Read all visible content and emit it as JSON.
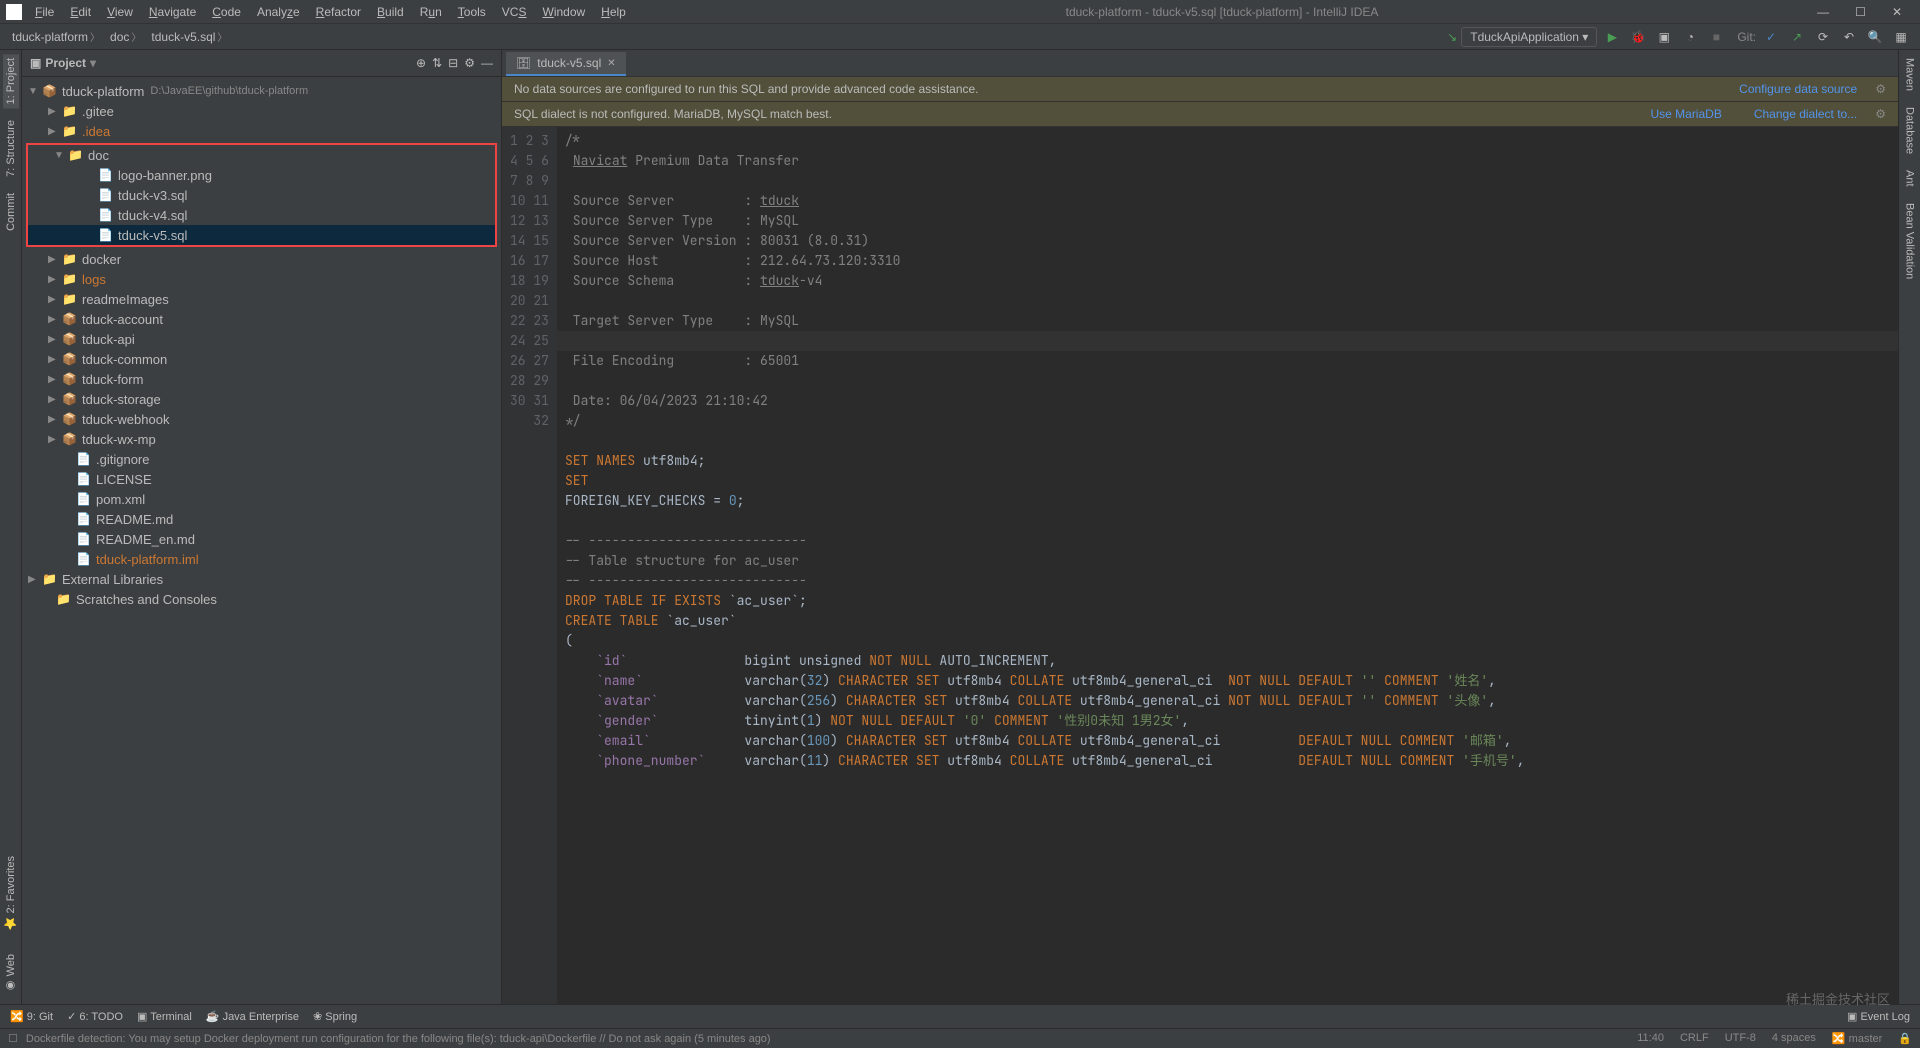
{
  "title_bar": "tduck-platform - tduck-v5.sql [tduck-platform] - IntelliJ IDEA",
  "menu": [
    "File",
    "Edit",
    "View",
    "Navigate",
    "Code",
    "Analyze",
    "Refactor",
    "Build",
    "Run",
    "Tools",
    "VCS",
    "Window",
    "Help"
  ],
  "breadcrumb": [
    "tduck-platform",
    "doc",
    "tduck-v5.sql"
  ],
  "run_config": "TduckApiApplication",
  "git_label": "Git:",
  "left_tabs": [
    "1: Project",
    "7: Structure",
    "Commit"
  ],
  "right_tabs": [
    "Maven",
    "Database",
    "Ant",
    "Bean Validation"
  ],
  "project": {
    "title": "Project",
    "root": {
      "label": "tduck-platform",
      "hint": "D:\\JavaEE\\github\\tduck-platform"
    },
    "tree_top": [
      ".gitee",
      ".idea"
    ],
    "doc": {
      "label": "doc",
      "children": [
        "logo-banner.png",
        "tduck-v3.sql",
        "tduck-v4.sql",
        "tduck-v5.sql"
      ]
    },
    "tree_mid": [
      "docker",
      "logs",
      "readmeImages",
      "tduck-account",
      "tduck-api",
      "tduck-common",
      "tduck-form",
      "tduck-storage",
      "tduck-webhook",
      "tduck-wx-mp"
    ],
    "tree_files": [
      ".gitignore",
      "LICENSE",
      "pom.xml",
      "README.md",
      "README_en.md",
      "tduck-platform.iml"
    ],
    "ext_lib": "External Libraries",
    "scratch": "Scratches and Consoles"
  },
  "tab": {
    "label": "tduck-v5.sql"
  },
  "banners": {
    "b1_text": "No data sources are configured to run this SQL and provide advanced code assistance.",
    "b1_link": "Configure data source",
    "b2_text": "SQL dialect is not configured. MariaDB, MySQL match best.",
    "b2_link1": "Use MariaDB",
    "b2_link2": "Change dialect to..."
  },
  "code_lines": [
    1,
    2,
    3,
    4,
    5,
    6,
    7,
    8,
    9,
    10,
    11,
    12,
    13,
    14,
    15,
    16,
    17,
    18,
    19,
    20,
    21,
    22,
    23,
    24,
    25,
    26,
    27,
    28,
    29,
    30,
    31,
    32
  ],
  "bottom": [
    "9: Git",
    "6: TODO",
    "Terminal",
    "Java Enterprise",
    "Spring"
  ],
  "status": {
    "msg": "Dockerfile detection: You may setup Docker deployment run configuration for the following file(s): tduck-api\\Dockerfile // Do not ask again (5 minutes ago)",
    "pos": "11:40",
    "crlf": "CRLF",
    "enc": "UTF-8",
    "indent": "4 spaces",
    "branch": "master"
  },
  "watermark": "稀土掘金技术社区"
}
